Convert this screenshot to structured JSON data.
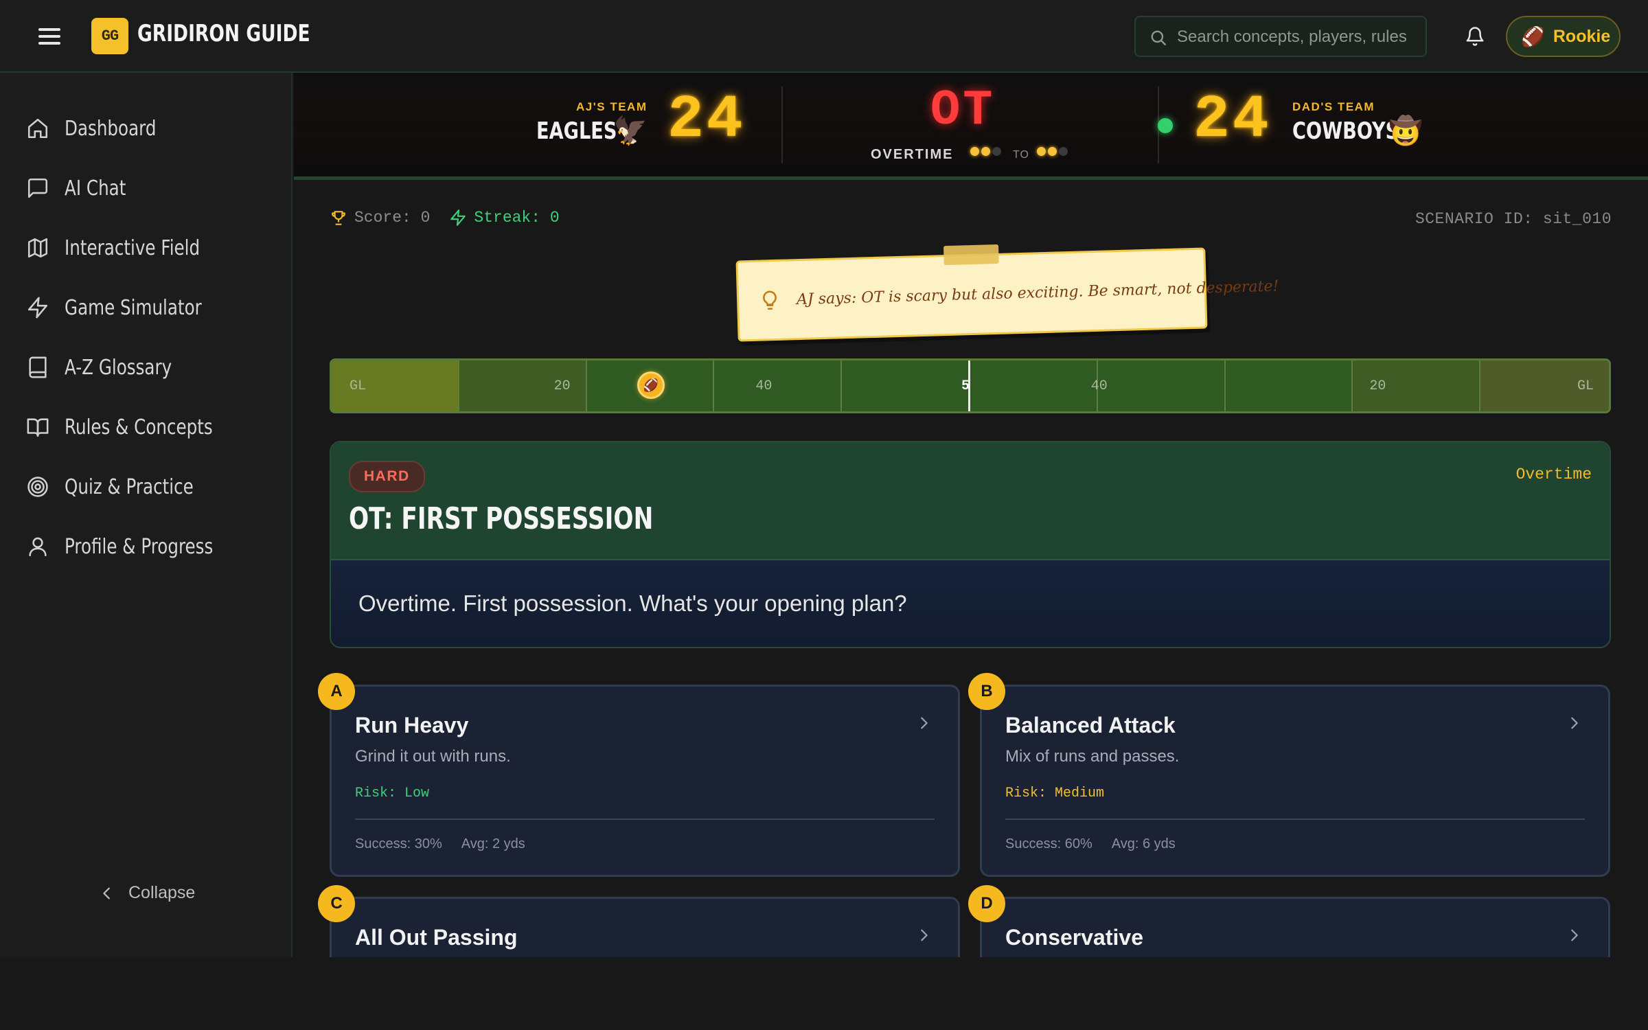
{
  "header": {
    "logo_text": "GG",
    "brand": "GRIDIRON GUIDE",
    "search_placeholder": "Search concepts, players, rules",
    "user_badge": "Rookie",
    "user_badge_emoji": "🏈"
  },
  "sidebar": {
    "items": [
      {
        "label": "Dashboard",
        "icon": "home-icon"
      },
      {
        "label": "AI Chat",
        "icon": "chat-icon"
      },
      {
        "label": "Interactive Field",
        "icon": "map-icon"
      },
      {
        "label": "Game Simulator",
        "icon": "lightning-icon"
      },
      {
        "label": "A-Z Glossary",
        "icon": "book-icon"
      },
      {
        "label": "Rules & Concepts",
        "icon": "open-book-icon"
      },
      {
        "label": "Quiz & Practice",
        "icon": "target-icon"
      },
      {
        "label": "Profile & Progress",
        "icon": "user-icon"
      }
    ],
    "collapse_label": "Collapse"
  },
  "scoreboard": {
    "home": {
      "label": "AJ'S TEAM",
      "name": "EAGLES",
      "emoji": "🦅",
      "score": "24"
    },
    "away": {
      "label": "DAD'S TEAM",
      "name": "COWBOYS",
      "emoji": "🤠",
      "score": "24"
    },
    "period": "OT",
    "period_label": "OVERTIME",
    "to_label": "TO",
    "home_timeouts": {
      "remaining": 2,
      "total": 3
    },
    "away_timeouts": {
      "remaining": 2,
      "total": 3
    },
    "possession": "away"
  },
  "stats": {
    "score_text": "Score: 0",
    "streak_text": "Streak: 0",
    "scenario_id": "SCENARIO ID: sit_010"
  },
  "note": {
    "text": "AJ says: OT is scary but also exciting. Be smart, not desperate!"
  },
  "field": {
    "labels": [
      "GL",
      "20",
      "",
      "40",
      "50",
      "40",
      "",
      "20",
      "GL"
    ],
    "ball_emoji": "🏈"
  },
  "scenario": {
    "difficulty": "HARD",
    "title": "OT: FIRST POSSESSION",
    "type": "Overtime",
    "question": "Overtime. First possession. What's your opening plan?"
  },
  "options": [
    {
      "letter": "A",
      "title": "Run Heavy",
      "desc": "Grind it out with runs.",
      "risk": "Risk: Low",
      "risk_color": "#3fd07a",
      "success": "Success: 30%",
      "avg": "Avg: 2 yds"
    },
    {
      "letter": "B",
      "title": "Balanced Attack",
      "desc": "Mix of runs and passes.",
      "risk": "Risk: Medium",
      "risk_color": "#f5c02a",
      "success": "Success: 60%",
      "avg": "Avg: 6 yds"
    },
    {
      "letter": "C",
      "title": "All Out Passing",
      "desc": "",
      "risk": "",
      "risk_color": "#ff6b5a",
      "success": "",
      "avg": ""
    },
    {
      "letter": "D",
      "title": "Conservative",
      "desc": "",
      "risk": "",
      "risk_color": "#3fd07a",
      "success": "",
      "avg": ""
    }
  ],
  "colors": {
    "accent_yellow": "#f5c02a",
    "field_green": "#2f5a22",
    "scenario_green": "#1f4530",
    "danger_red": "#ff3b3b",
    "success_green": "#3fd07a"
  }
}
